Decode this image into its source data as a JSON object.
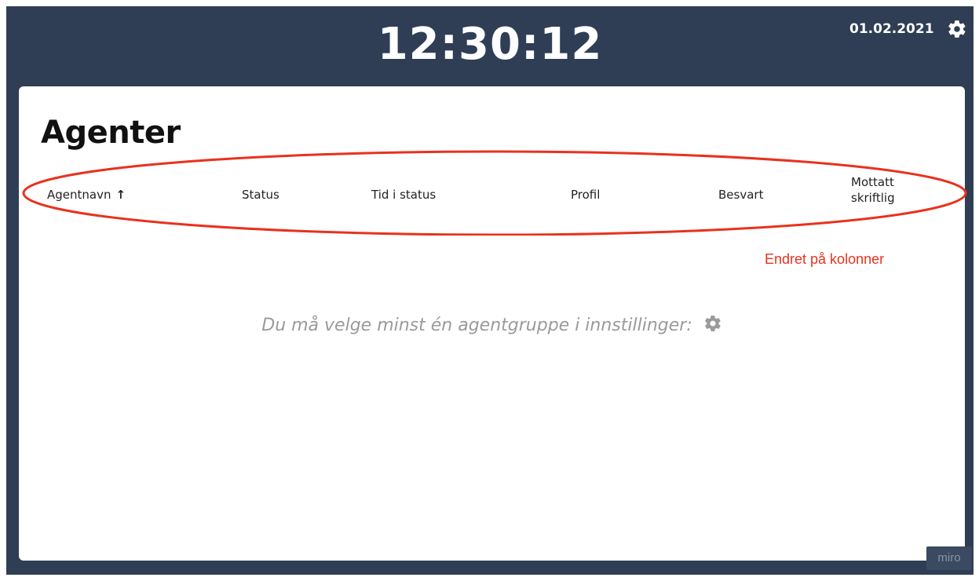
{
  "header": {
    "clock": "12:30:12",
    "date": "01.02.2021",
    "settings_icon": "gear-icon"
  },
  "panel": {
    "title": "Agenter",
    "columns": [
      {
        "label": "Agentnavn",
        "sort": "↑"
      },
      {
        "label": "Status"
      },
      {
        "label": "Tid i status"
      },
      {
        "label": "Profil"
      },
      {
        "label": "Besvart"
      },
      {
        "label": "Mottatt\nskriftlig"
      }
    ],
    "empty_message": "Du må velge minst én agentgruppe i innstillinger:",
    "empty_icon": "gear-icon"
  },
  "annotation": {
    "text": "Endret på kolonner",
    "color": "#e8321d"
  },
  "watermark": {
    "text": "miro"
  },
  "colors": {
    "background": "#2f3e55",
    "panel": "#ffffff",
    "annotation": "#e8321d"
  }
}
